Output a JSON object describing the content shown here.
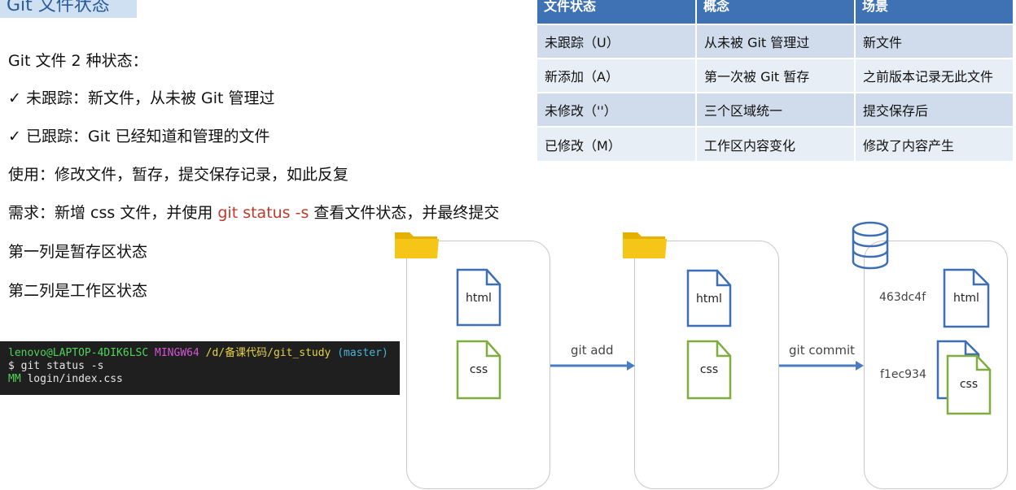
{
  "title": "Git 文件状态",
  "lines": {
    "intro": "Git 文件 2 种状态：",
    "check1": "未跟踪：新文件，从未被 Git 管理过",
    "check2": "已跟踪：Git 已经知道和管理的文件",
    "usage": "使用：修改文件，暂存，提交保存记录，如此反复",
    "req_prefix": "需求：新增 css 文件，并使用 ",
    "req_cmd": "git status -s",
    "req_suffix": " 查看文件状态，并最终提交",
    "col1": "第一列是暂存区状态",
    "col2": "第二列是工作区状态",
    "check_mark": "✓"
  },
  "terminal": {
    "user_host": "lenovo@LAPTOP-4DIK6LSC",
    "shell": "MINGW64",
    "path": "/d/备课代码/git_study",
    "branch": "(master)",
    "prompt": "$ git status -s",
    "status_code": "MM",
    "file": " login/index.css"
  },
  "table": {
    "headers": [
      "文件状态",
      "概念",
      "场景"
    ],
    "rows": [
      [
        "未跟踪（U）",
        "从未被 Git 管理过",
        "新文件"
      ],
      [
        "新添加（A）",
        "第一次被 Git 暂存",
        "之前版本记录无此文件"
      ],
      [
        "未修改（''）",
        "三个区域统一",
        "提交保存后"
      ],
      [
        "已修改（M）",
        "工作区内容变化",
        "修改了内容产生"
      ]
    ]
  },
  "diagram": {
    "html_label": "html",
    "css_label": "css",
    "arrow1": "git add",
    "arrow2": "git commit",
    "hash1": "463dc4f",
    "hash2": "f1ec934",
    "colors": {
      "html_doc": "#3d6fb6",
      "css_doc": "#7fae3f",
      "arrow": "#4a7cc0",
      "folder": "#f5c518",
      "database": "#3d6fb6"
    }
  }
}
